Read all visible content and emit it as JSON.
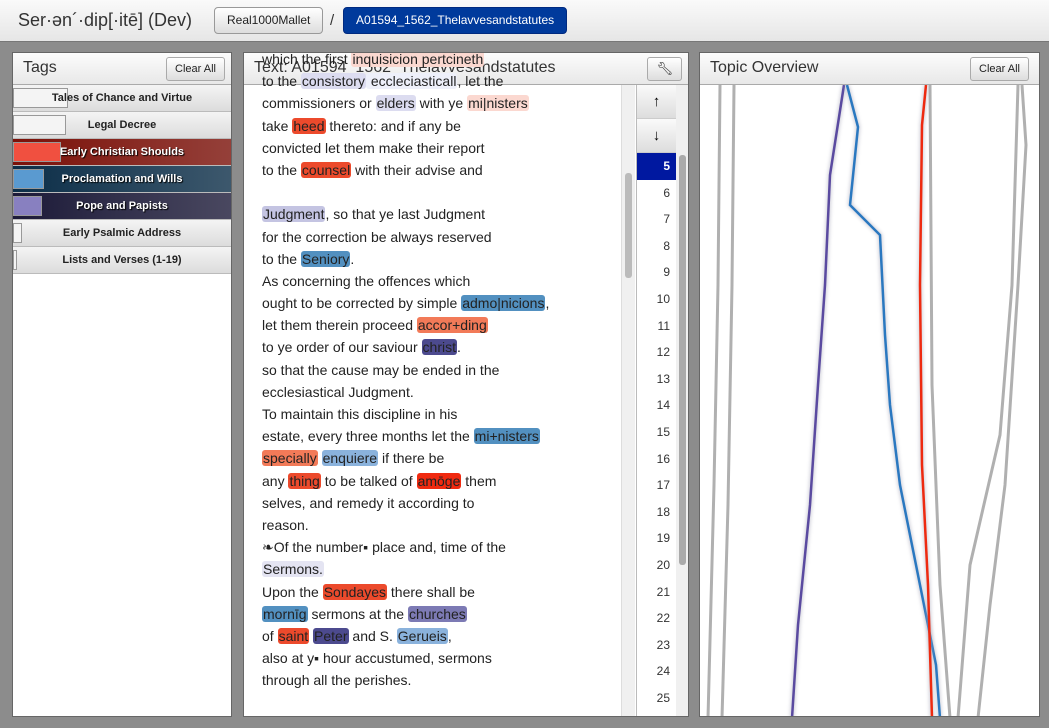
{
  "header": {
    "title": "Ser·ən´·dip[·itē] (Dev)",
    "crumb1": "Real1000Mallet",
    "sep": "/",
    "crumb2": "A01594_1562_Thelavvesandstatutes"
  },
  "tags": {
    "title": "Tags",
    "clear": "Clear All",
    "items": [
      {
        "label": "Tales of Chance and Virtue",
        "swatch": "#f4f4f4",
        "level": 0.25,
        "dark": false
      },
      {
        "label": "Legal Decree",
        "swatch": "#f4f4f4",
        "level": 0.24,
        "dark": false
      },
      {
        "label": "Early Christian Shoulds",
        "swatch": "#f05040",
        "level": 0.22,
        "dark": true,
        "bg": "#7a1008"
      },
      {
        "label": "Proclamation and Wills",
        "swatch": "#5a9ad0",
        "level": 0.14,
        "dark": true,
        "bg": "#0c2e48"
      },
      {
        "label": "Pope and Papists",
        "swatch": "#8880c0",
        "level": 0.13,
        "dark": true,
        "bg": "#1c1a38"
      },
      {
        "label": "Early Psalmic Address",
        "swatch": "#f4f4f4",
        "level": 0.04,
        "dark": false
      },
      {
        "label": "Lists and Verses (1-19)",
        "swatch": "#f4f4f4",
        "level": 0.02,
        "dark": false
      }
    ]
  },
  "text": {
    "title": "Text: A01594_1562_Thelavvesandstatutes",
    "wrench": "wrench-icon",
    "lines": [
      [
        [
          "which the first "
        ],
        [
          "inquisicion pertcineth",
          "peach"
        ]
      ],
      [
        [
          "to the "
        ],
        [
          "consistory",
          "lav"
        ],
        [
          " eccleciasticall",
          "pale"
        ],
        [
          ", let the"
        ]
      ],
      [
        [
          "commissioners or "
        ],
        [
          "elders",
          "lav"
        ],
        [
          " with ye "
        ],
        [
          "mi|nisters",
          "peach"
        ]
      ],
      [
        [
          "take "
        ],
        [
          "heed",
          "red"
        ],
        [
          " thereto: and if any be"
        ]
      ],
      [
        [
          "convicted let them make their report"
        ]
      ],
      [
        [
          "to the "
        ],
        [
          "counsel",
          "red"
        ],
        [
          " with their advise and"
        ]
      ],
      [
        [
          ""
        ]
      ],
      [
        [
          "Judgment",
          "lav2"
        ],
        [
          ", so that ye last Judgment"
        ]
      ],
      [
        [
          "for the correction be always reserved"
        ]
      ],
      [
        [
          "to the "
        ],
        [
          "Seniory",
          "blue"
        ],
        [
          "."
        ]
      ],
      [
        [
          "As concerning the offences which"
        ]
      ],
      [
        [
          "ought to be corrected by simple "
        ],
        [
          "admo|nicions",
          "blue"
        ],
        [
          ","
        ]
      ],
      [
        [
          "let them therein proceed "
        ],
        [
          "accor+ding",
          "salmon"
        ]
      ],
      [
        [
          "to ye order of our saviour "
        ],
        [
          "christ",
          "dpurp"
        ],
        [
          "."
        ]
      ],
      [
        [
          "so that the cause may be ended in the"
        ]
      ],
      [
        [
          "ecclesiastical Judgment."
        ]
      ],
      [
        [
          "To maintain this discipline in his"
        ]
      ],
      [
        [
          "estate, every three months let the "
        ],
        [
          "mi+nisters",
          "blue"
        ]
      ],
      [
        [
          "specially",
          "salmon"
        ],
        [
          " "
        ],
        [
          "enquiere",
          "lblue"
        ],
        [
          " if there be"
        ]
      ],
      [
        [
          "any "
        ],
        [
          "thing",
          "red"
        ],
        [
          " to be talked of "
        ],
        [
          "amōge",
          "red2"
        ],
        [
          " them"
        ]
      ],
      [
        [
          "selves, and remedy it according to"
        ]
      ],
      [
        [
          "reason."
        ]
      ],
      [
        [
          "❧Of the number▪ place and, time of the"
        ]
      ],
      [
        [
          "Sermons.",
          "pale2"
        ]
      ],
      [
        [
          "Upon the "
        ],
        [
          "Sondayes",
          "red"
        ],
        [
          " there shall be"
        ]
      ],
      [
        [
          "mornīg",
          "blue"
        ],
        [
          " sermons at the "
        ],
        [
          "churches",
          "mpurp"
        ]
      ],
      [
        [
          "of "
        ],
        [
          "saint",
          "red"
        ],
        [
          " "
        ],
        [
          "Peter",
          "dpurp"
        ],
        [
          " and S. "
        ],
        [
          "Gerueis",
          "lblue"
        ],
        [
          ","
        ]
      ],
      [
        [
          "also at y▪ hour accustumed, sermons"
        ]
      ],
      [
        [
          "through all the perishes."
        ]
      ]
    ],
    "up": "↑",
    "down": "↓",
    "pages": [
      "5",
      "6",
      "7",
      "8",
      "9",
      "10",
      "11",
      "12",
      "13",
      "14",
      "15",
      "16",
      "17",
      "18",
      "19",
      "20",
      "21",
      "22",
      "23",
      "24",
      "25"
    ],
    "selected_page": "5"
  },
  "highlight_colors": {
    "peach": "#fbd8d0",
    "lav": "#dcdcf0",
    "pale": "#eef0fa",
    "red": "#ec4a2c",
    "red2": "#f02a10",
    "salmon": "#f27a58",
    "blue": "#5290c0",
    "lblue": "#8ab2dc",
    "dpurp": "#4c4a8e",
    "mpurp": "#7c7ab4",
    "lav2": "#c4c4e2",
    "pale2": "#e4e4f2"
  },
  "topic": {
    "title": "Topic Overview",
    "clear": "Clear All",
    "colors": {
      "purple": "#5a4aa0",
      "blue": "#2a78c0",
      "red": "#ee2a10",
      "gray": "#b0b0b0"
    }
  }
}
